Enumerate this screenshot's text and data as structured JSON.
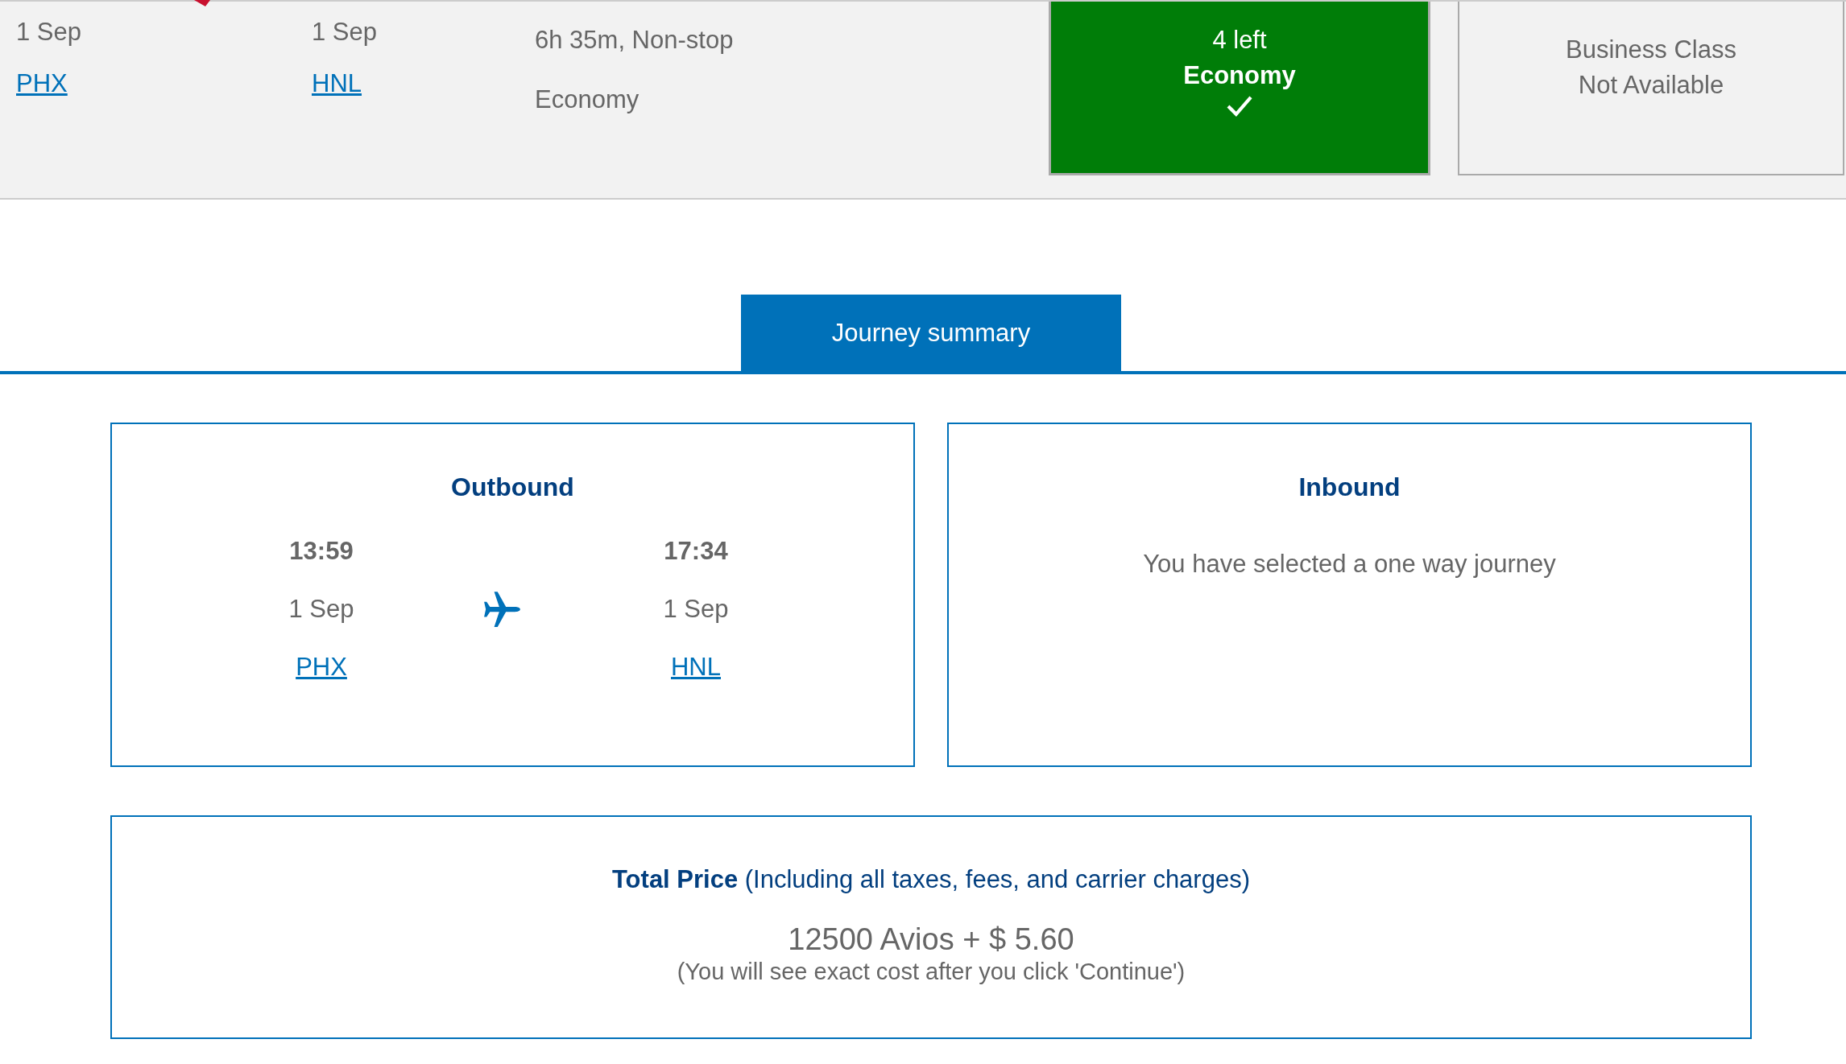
{
  "flight": {
    "departure": {
      "date": "1 Sep",
      "airport": "PHX"
    },
    "arrival": {
      "date": "1 Sep",
      "airport": "HNL"
    },
    "duration": "6h 35m, Non-stop",
    "cabin": "Economy"
  },
  "fares": [
    {
      "kind": "available",
      "availability": "4 left",
      "cabin": "Economy",
      "selected": true
    },
    {
      "kind": "unavailable",
      "cabin": "Business Class",
      "status": "Not Available",
      "selected": false
    }
  ],
  "summary_tab": {
    "label": "Journey summary",
    "selected": true
  },
  "outbound": {
    "title": "Outbound",
    "departure": {
      "time": "13:59",
      "date": "1 Sep",
      "airport": "PHX"
    },
    "arrival": {
      "time": "17:34",
      "date": "1 Sep",
      "airport": "HNL"
    }
  },
  "inbound": {
    "title": "Inbound",
    "message": "You have selected a one way journey"
  },
  "total": {
    "label": "**Total Price** (Including all taxes, fees, and carrier charges)",
    "price": "12500 Avios + $ 5.60",
    "note": "(You will see exact cost after you click 'Continue')"
  }
}
